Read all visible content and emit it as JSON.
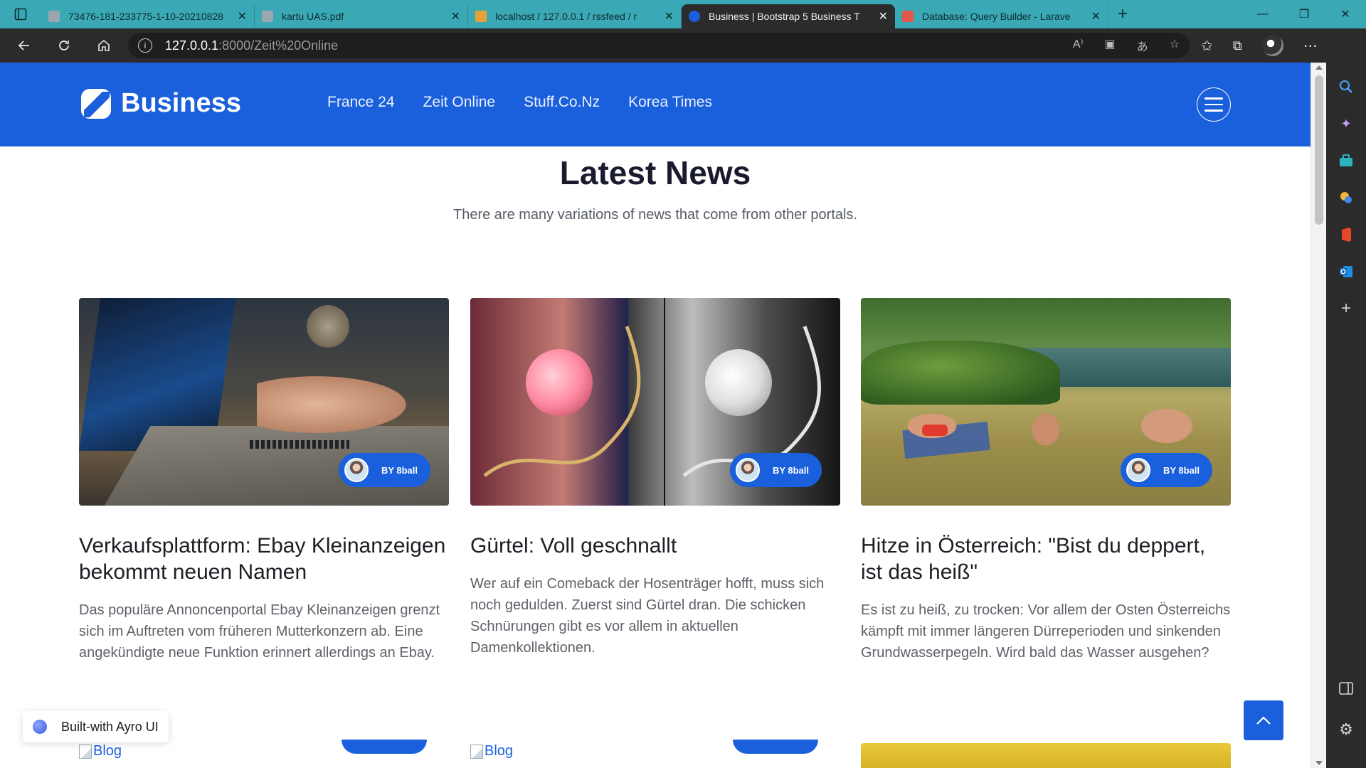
{
  "browser": {
    "tabs": [
      {
        "title": "73476-181-233775-1-10-20210828",
        "favicon_color": "#9aa7b0",
        "active": false
      },
      {
        "title": "kartu UAS.pdf",
        "favicon_color": "#9aa7b0",
        "active": false
      },
      {
        "title": "localhost / 127.0.0.1 / rssfeed / r",
        "favicon_color": "#e3a23a",
        "active": false
      },
      {
        "title": "Business | Bootstrap 5 Business T",
        "favicon_color": "#1a5fdb",
        "active": true
      },
      {
        "title": "Database: Query Builder - Larave",
        "favicon_color": "#e2574c",
        "active": false
      }
    ],
    "url_host": "127.0.0.1",
    "url_rest": ":8000/Zeit%20Online",
    "icons": {
      "back": "back-arrow-icon",
      "refresh": "refresh-icon",
      "home": "home-icon",
      "info": "info-icon",
      "read_aloud": "read-aloud-icon",
      "immersive_reader": "immersive-reader-icon",
      "translate": "translate-icon",
      "add_favorite": "add-favorite-icon",
      "favorites": "favorites-icon",
      "collections": "collections-icon",
      "more": "more-icon"
    },
    "sidebar_icons": [
      "search-icon",
      "copilot-icon",
      "shopping-icon",
      "tools-icon",
      "office-icon",
      "outlook-icon",
      "add-icon"
    ],
    "sidebar_bottom_icons": [
      "sidebar-toggle-icon",
      "settings-icon"
    ]
  },
  "site": {
    "brand": "Business",
    "accent_color": "#1a5fdb",
    "nav": [
      "France 24",
      "Zeit Online",
      "Stuff.Co.Nz",
      "Korea Times"
    ],
    "section_title": "Latest News",
    "section_subtitle": "There are many variations of news that come from other portals.",
    "cards": [
      {
        "author": "BY 8ball",
        "title": "Verkaufsplattform: Ebay Kleinanzeigen bekommt neuen Namen",
        "description": "Das populäre Annoncenportal Ebay Kleinanzeigen grenzt sich im Auftreten vom früheren Mutterkonzern ab. Eine angekündigte neue Funktion erinnert allerdings an Ebay."
      },
      {
        "author": "BY 8ball",
        "title": "Gürtel: Voll geschnallt",
        "description": "Wer auf ein Comeback der Hosenträger hofft, muss sich noch gedulden. Zuerst sind Gürtel dran. Die schicken Schnürungen gibt es vor allem in aktuellen Damenkollektionen."
      },
      {
        "author": "BY 8ball",
        "title": "Hitze in Österreich: \"Bist du deppert, ist das heiß\"",
        "description": "Es ist zu heiß, zu trocken: Vor allem der Osten Österreichs kämpft mit immer längeren Dürreperioden und sinkenden Grundwasserpegeln. Wird bald das Wasser ausgehen?"
      }
    ],
    "broken_image_alt": "Blog",
    "built_with": "Built-with Ayro UI"
  }
}
